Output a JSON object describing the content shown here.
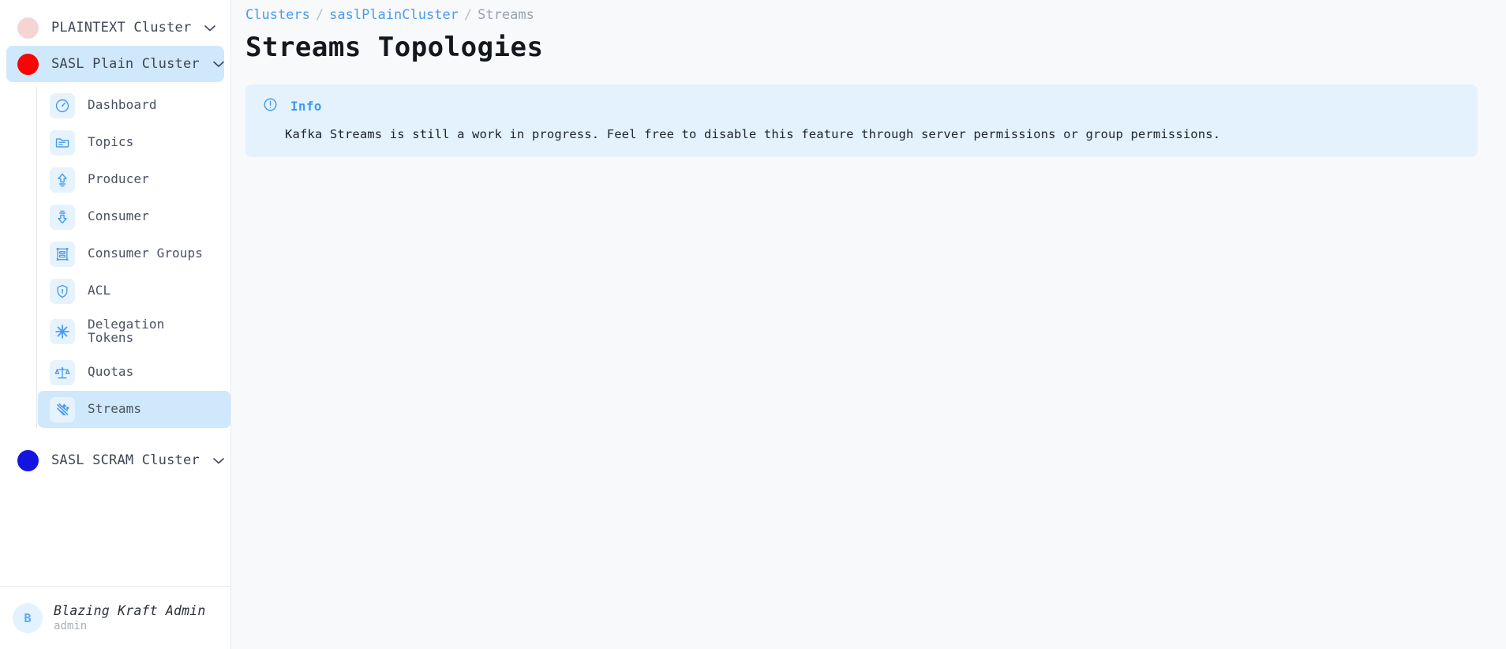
{
  "sidebar": {
    "clusters": [
      {
        "name": "PLAINTEXT Cluster",
        "dot_color": "#f7d4d4",
        "chevron": "^",
        "expanded": false,
        "active": false
      },
      {
        "name": "SASL Plain Cluster",
        "dot_color": "#fa0505",
        "chevron": "v",
        "expanded": true,
        "active": true
      },
      {
        "name": "SASL SCRAM Cluster",
        "dot_color": "#1414e0",
        "chevron": "^",
        "expanded": false,
        "active": false
      }
    ],
    "menu_items": [
      {
        "label": "Dashboard",
        "icon": "gauge-icon",
        "selected": false
      },
      {
        "label": "Topics",
        "icon": "folder-icon",
        "selected": false
      },
      {
        "label": "Producer",
        "icon": "upload-arrow-icon",
        "selected": false
      },
      {
        "label": "Consumer",
        "icon": "download-arrow-icon",
        "selected": false
      },
      {
        "label": "Consumer Groups",
        "icon": "group-list-icon",
        "selected": false
      },
      {
        "label": "ACL",
        "icon": "shield-icon",
        "selected": false
      },
      {
        "label": "Delegation\nTokens",
        "icon": "asterisk-icon",
        "selected": false
      },
      {
        "label": "Quotas",
        "icon": "scales-icon",
        "selected": false
      },
      {
        "label": "Streams",
        "icon": "streams-icon",
        "selected": true
      }
    ],
    "user": {
      "avatar_initial": "B",
      "name": "Blazing Kraft Admin",
      "role": "admin"
    }
  },
  "main": {
    "breadcrumb": {
      "root": "Clusters",
      "sep": "/",
      "cluster": "saslPlainCluster",
      "current": "Streams"
    },
    "title": "Streams Topologies",
    "info": {
      "icon": "info-circle-icon",
      "label": "Info",
      "message": "Kafka Streams is still a work in progress. Feel free to disable this feature through server permissions or group permissions."
    }
  },
  "colors": {
    "accent": "#4a9bf0",
    "info_bg": "#e3f2fd",
    "selected_bg": "#cfe8fb",
    "page_bg": "#f8f9fb"
  }
}
